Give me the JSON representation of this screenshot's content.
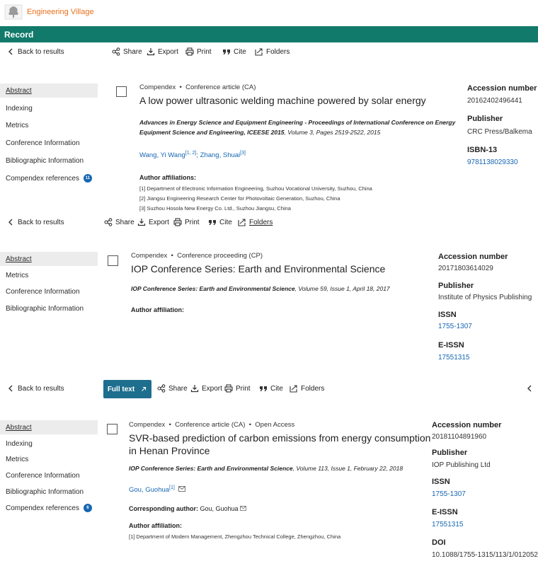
{
  "brand": {
    "name": "Engineering Village",
    "logo_icon": "elsevier-tree-icon",
    "color": "#e9711c"
  },
  "record_bar": {
    "label": "Record",
    "color": "#127a6b"
  },
  "toolbar": {
    "back": "Back to results",
    "share": "Share",
    "export": "Export",
    "print": "Print",
    "cite": "Cite",
    "folders": "Folders",
    "full_text": "Full text"
  },
  "record1": {
    "nav": [
      "Abstract",
      "Indexing",
      "Metrics",
      "Conference Information",
      "Bibliographic Information",
      "Compendex references"
    ],
    "references_count": "11",
    "database": "Compendex",
    "doc_type": "Conference article (CA)",
    "title": "A low power ultrasonic welding machine powered by solar energy",
    "source_line1": "Advances in Energy Science and Equipment Engineering - Proceedings of International Conference on Energy",
    "source_line2": "Equipment Science and Engineering, ICEESE 2015",
    "source_details": ", Volume 3, Pages 2519-2522, 2015",
    "author1": "Wang, Yi Wang",
    "author1_sup": "[1, 2]",
    "author2": "Zhang, Shuai",
    "author2_sup": "[3]",
    "affiliations_label": "Author affiliations:",
    "affiliations": [
      "[1] Department of Electronic Information Engineering, Suzhou Vocational University, Suzhou, China",
      "[2] Jiangsu Engineering Research Center for Photovoltaic Generation, Suzhou, China",
      "[3] Suzhou Hosola New Energy Co. Ltd., Suzhou Jiangsu, China"
    ],
    "accession_label": "Accession number",
    "accession": "20162402496441",
    "publisher_label": "Publisher",
    "publisher": "CRC Press/Balkema",
    "isbn_label": "ISBN-13",
    "isbn": "9781138029330"
  },
  "record2": {
    "nav": [
      "Abstract",
      "Metrics",
      "Conference Information",
      "Bibliographic Information"
    ],
    "database": "Compendex",
    "doc_type": "Conference proceeding (CP)",
    "title": "IOP Conference Series: Earth and Environmental Science",
    "source": "IOP Conference Series: Earth and Environmental Science",
    "source_details": ", Volume 59, Issue 1, April 18, 2017",
    "affiliation_label": "Author affiliation:",
    "accession_label": "Accession number",
    "accession": "20171803614029",
    "publisher_label": "Publisher",
    "publisher": "Institute of Physics Publishing",
    "issn_label": "ISSN",
    "issn": "1755-1307",
    "eissn_label": "E-ISSN",
    "eissn": "17551315"
  },
  "record3": {
    "nav": [
      "Abstract",
      "Indexing",
      "Metrics",
      "Conference Information",
      "Bibliographic Information",
      "Compendex references"
    ],
    "references_count": "6",
    "database": "Compendex",
    "doc_type": "Conference article (CA)",
    "access": "Open Access",
    "title_line1": "SVR-based prediction of carbon emissions from energy consumption",
    "title_line2": "in Henan Province",
    "source": "IOP Conference Series: Earth and Environmental Science",
    "source_details": ", Volume 113, Issue 1, February 22, 2018",
    "author": "Gou, Guohua",
    "author_sup": "[1]",
    "corresponding_label": "Corresponding author:",
    "corresponding_name": "Gou, Guohua",
    "affiliation_label": "Author affiliation:",
    "affiliation": "[1] Department of Modern Management, Zhengzhou Technical College, Zhengzhou, China",
    "accession_label": "Accession number",
    "accession": "20181104891960",
    "publisher_label": "Publisher",
    "publisher": "IOP Publishing Ltd",
    "issn_label": "ISSN",
    "issn": "1755-1307",
    "eissn_label": "E-ISSN",
    "eissn": "17551315",
    "doi_label": "DOI",
    "doi": "10.1088/1755-1315/113/1/012052"
  }
}
